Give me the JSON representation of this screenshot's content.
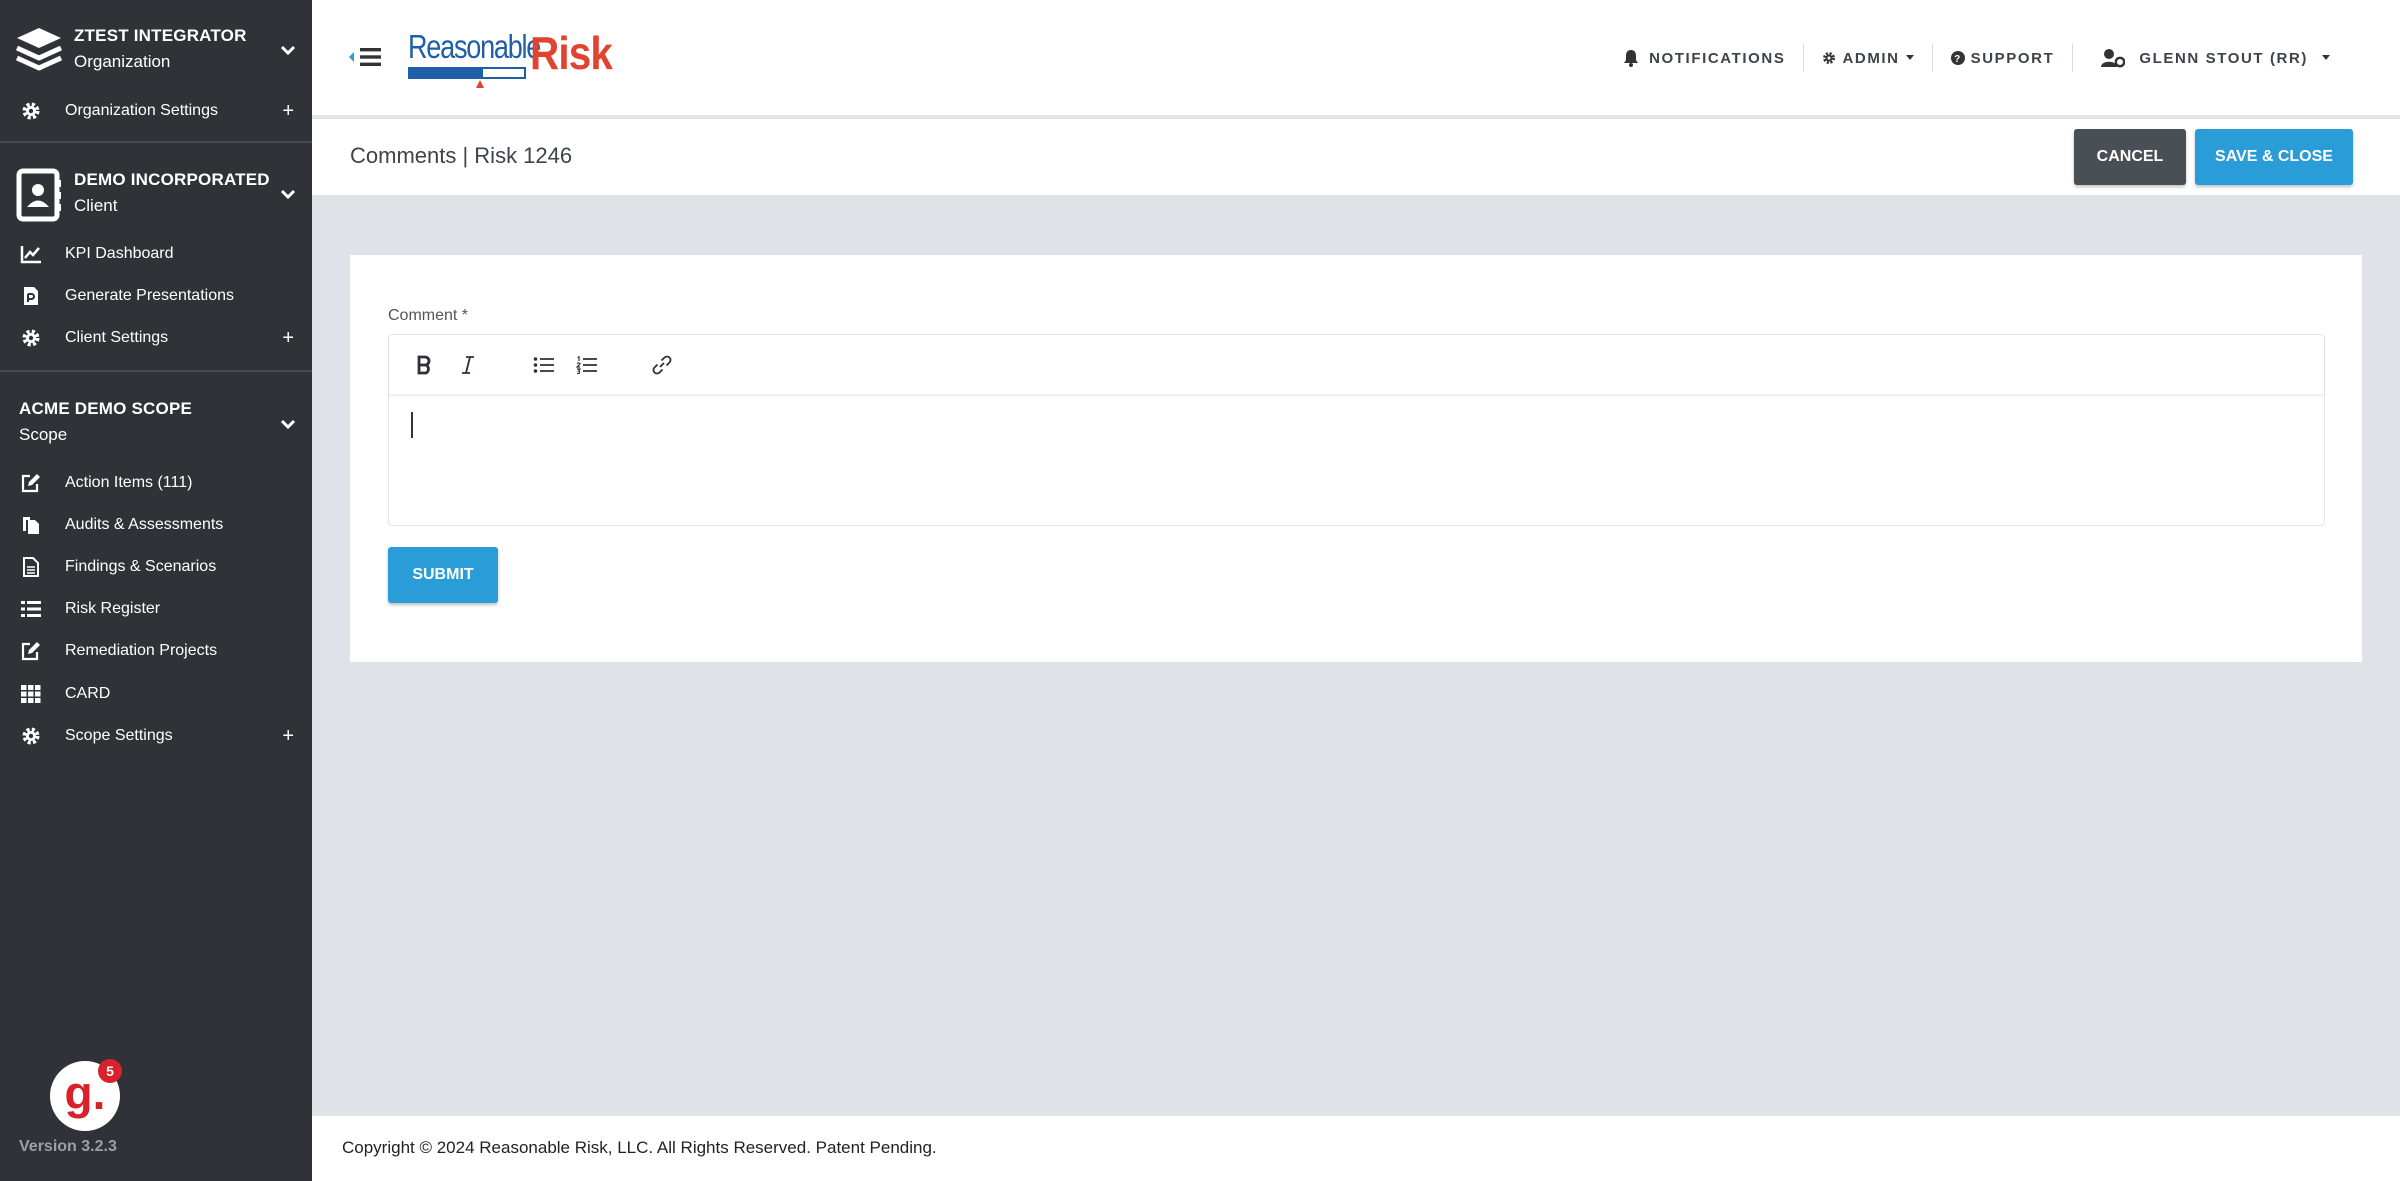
{
  "sidebar": {
    "org": {
      "title": "ZTEST INTEGRATOR",
      "sub": "Organization"
    },
    "org_items": [
      {
        "label": "Organization Settings",
        "icon": "gear-icon",
        "plus": "+"
      }
    ],
    "client": {
      "title": "DEMO INCORPORATED",
      "sub": "Client"
    },
    "client_items": [
      {
        "label": "KPI Dashboard",
        "icon": "chart-line-icon"
      },
      {
        "label": "Generate Presentations",
        "icon": "file-presentation-icon"
      },
      {
        "label": "Client Settings",
        "icon": "gear-icon",
        "plus": "+"
      }
    ],
    "scope": {
      "title": "ACME DEMO SCOPE",
      "sub": "Scope"
    },
    "scope_items": [
      {
        "label": "Action Items (111)",
        "icon": "edit-icon"
      },
      {
        "label": "Audits & Assessments",
        "icon": "copy-files-icon"
      },
      {
        "label": "Findings & Scenarios",
        "icon": "document-icon"
      },
      {
        "label": "Risk Register",
        "icon": "list-icon"
      },
      {
        "label": "Remediation Projects",
        "icon": "edit-icon"
      },
      {
        "label": "CARD",
        "icon": "grid-icon"
      },
      {
        "label": "Scope Settings",
        "icon": "gear-icon",
        "plus": "+"
      }
    ],
    "version": "Version 3.2.3",
    "badge_letter": "g.",
    "badge_count": "5"
  },
  "header": {
    "logo_left": "Reasonable",
    "logo_right": "Risk",
    "notifications": "NOTIFICATIONS",
    "admin": "ADMIN",
    "support": "SUPPORT",
    "user": "GLENN STOUT (RR)"
  },
  "titlebar": {
    "title": "Comments | Risk 1246",
    "cancel": "CANCEL",
    "save": "SAVE & CLOSE"
  },
  "form": {
    "label": "Comment *",
    "submit": "SUBMIT"
  },
  "footer": {
    "copyright": "Copyright © 2024 Reasonable Risk, LLC. All Rights Reserved. Patent Pending."
  },
  "colors": {
    "sidebar_bg": "#2f3337",
    "primary": "#2a9cd8",
    "dark_button": "#4a4f55",
    "logo_blue": "#1f5fa8",
    "logo_red": "#e0432f",
    "content_bg": "#dfe2e6"
  }
}
